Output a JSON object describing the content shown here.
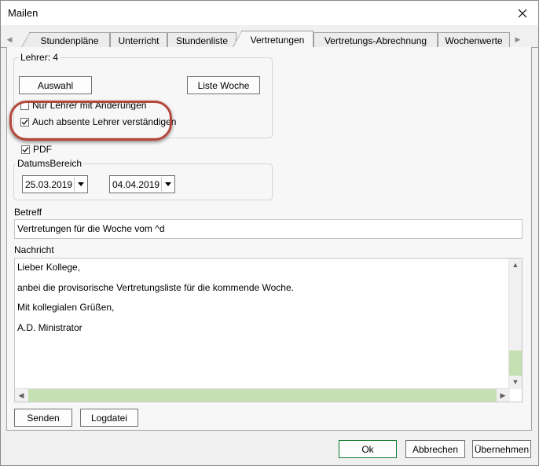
{
  "window": {
    "title": "Mailen"
  },
  "tabs": [
    {
      "label": "Stundenpläne"
    },
    {
      "label": "Unterricht"
    },
    {
      "label": "Stundenliste"
    },
    {
      "label": "Vertretungen"
    },
    {
      "label": "Vertretungs-Abrechnung"
    },
    {
      "label": "Wochenwerte"
    }
  ],
  "lehrer_group": {
    "label": "Lehrer: 4",
    "auswahl_button": "Auswahl",
    "liste_woche_button": "Liste Woche",
    "nur_lehrer_label": "Nur Lehrer mit Änderungen",
    "nur_lehrer_checked": false,
    "absente_label": "Auch absente Lehrer verständigen",
    "absente_checked": true
  },
  "pdf": {
    "label": "PDF",
    "checked": true
  },
  "datums_bereich": {
    "label": "DatumsBereich",
    "from": "25.03.2019",
    "to": "04.04.2019"
  },
  "betreff": {
    "label": "Betreff",
    "value": "Vertretungen für die Woche vom ^d"
  },
  "nachricht": {
    "label": "Nachricht",
    "lines": [
      "Lieber Kollege,",
      "anbei die provisorische Vertretungsliste für die kommende Woche.",
      "Mit kollegialen Grüßen,",
      "A.D. Ministrator"
    ]
  },
  "panel_buttons": {
    "senden": "Senden",
    "logdatei": "Logdatei"
  },
  "footer": {
    "ok": "Ok",
    "abbrechen": "Abbrechen",
    "uebernehmen": "Übernehmen"
  },
  "colors": {
    "accent_green": "#c5e0b3",
    "highlight_oval": "#b5473a",
    "default_button_border": "#0f7a2a"
  },
  "icons": {
    "close": "close-icon",
    "tab_scroll_left": "chevron-left-icon",
    "tab_scroll_right": "chevron-right-icon",
    "dropdown": "chevron-down-icon",
    "check": "checkmark-icon"
  }
}
